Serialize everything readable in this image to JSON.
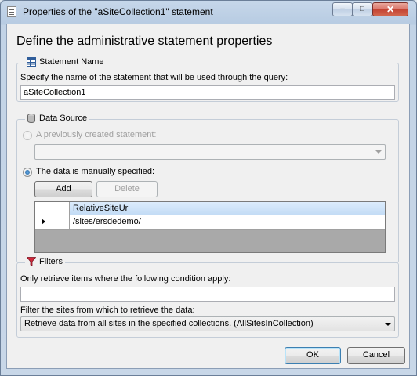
{
  "window": {
    "title": "Properties of the \"aSiteCollection1\" statement",
    "minimize_glyph": "–",
    "maximize_glyph": "□",
    "close_glyph": "✕"
  },
  "header": {
    "title": "Define the administrative statement properties"
  },
  "statement_name": {
    "group_label": "Statement Name",
    "description": "Specify the name of the statement that will be used through the query:",
    "value": "aSiteCollection1",
    "icon": "table-icon"
  },
  "data_source": {
    "group_label": "Data Source",
    "icon": "database-icon",
    "option_previous": {
      "label": "A previously created statement:",
      "selected": false,
      "enabled": false
    },
    "previous_combo_value": "",
    "option_manual": {
      "label": "The data is manually specified:",
      "selected": true
    },
    "add_label": "Add",
    "delete_label": "Delete",
    "grid": {
      "columns": [
        "RelativeSiteUrl"
      ],
      "rows": [
        [
          "/sites/ersdedemo/"
        ]
      ]
    }
  },
  "filters": {
    "group_label": "Filters",
    "icon": "funnel-icon",
    "condition_label": "Only retrieve items where the following condition apply:",
    "condition_value": "",
    "scope_label": "Filter the sites from which to retrieve the data:",
    "scope_value": "Retrieve data from all sites in the specified collections. (AllSitesInCollection)"
  },
  "footer": {
    "ok_label": "OK",
    "cancel_label": "Cancel"
  },
  "colors": {
    "accent": "#3c7fb1",
    "grid_header": "#c3dcf5",
    "titlebar": "#c6d7ea",
    "close_button": "#c44433"
  }
}
